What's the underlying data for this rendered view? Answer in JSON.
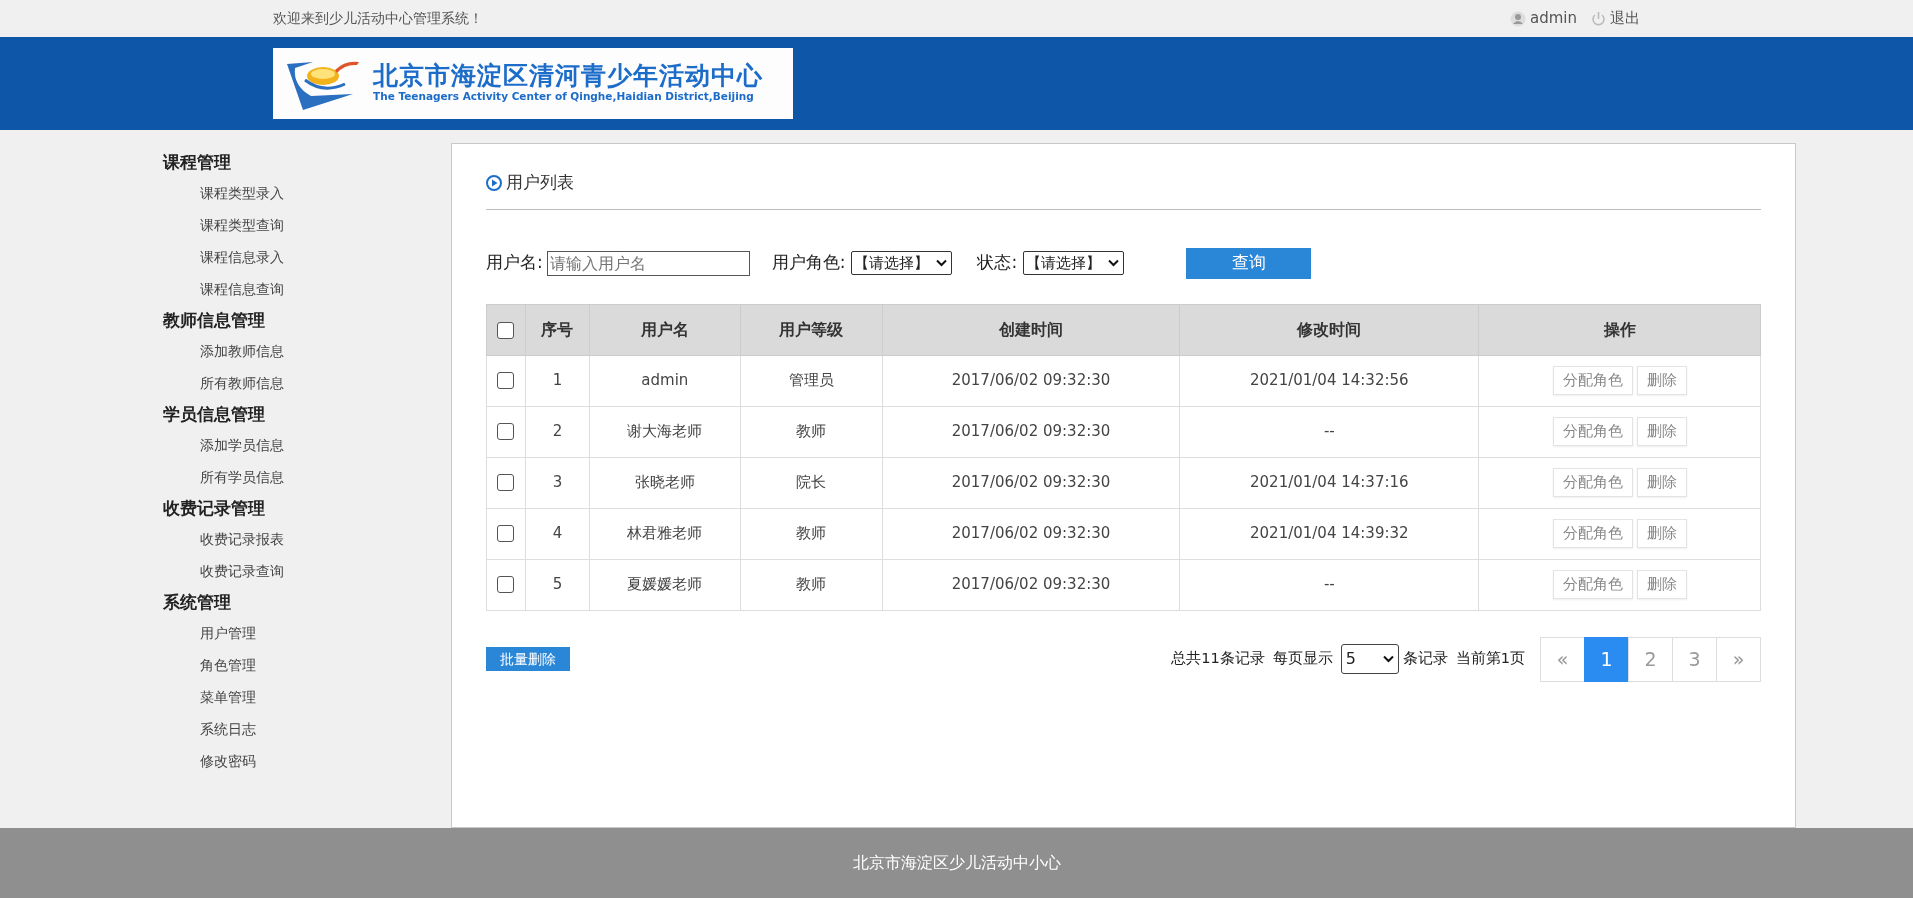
{
  "top_bar": {
    "welcome": "欢迎来到少儿活动中心管理系统！",
    "user": "admin",
    "logout": "退出"
  },
  "logo": {
    "title": "北京市海淀区清河青少年活动中心",
    "subtitle": "The Teenagers Activity Center of Qinghe,Haidian District,Beijing"
  },
  "sidebar": {
    "groups": [
      {
        "title": "课程管理",
        "items": [
          "课程类型录入",
          "课程类型查询",
          "课程信息录入",
          "课程信息查询"
        ]
      },
      {
        "title": "教师信息管理",
        "items": [
          "添加教师信息",
          "所有教师信息"
        ]
      },
      {
        "title": "学员信息管理",
        "items": [
          "添加学员信息",
          "所有学员信息"
        ]
      },
      {
        "title": "收费记录管理",
        "items": [
          "收费记录报表",
          "收费记录查询"
        ]
      },
      {
        "title": "系统管理",
        "items": [
          "用户管理",
          "角色管理",
          "菜单管理",
          "系统日志",
          "修改密码"
        ]
      }
    ]
  },
  "panel_title": "用户列表",
  "filters": {
    "username_label": "用户名:",
    "username_placeholder": "请输入用户名",
    "role_label": "用户角色:",
    "role_value": "【请选择】",
    "status_label": "状态:",
    "status_value": "【请选择】",
    "query_button": "查询"
  },
  "table": {
    "select_all_checked": false,
    "columns": [
      "序号",
      "用户名",
      "用户等级",
      "创建时间",
      "修改时间",
      "操作"
    ],
    "rows": [
      {
        "checked": false,
        "cells": [
          "1",
          "admin",
          "管理员",
          "2017/06/02 09:32:30",
          "2021/01/04 14:32:56"
        ],
        "actions": [
          "分配角色",
          "删除"
        ]
      },
      {
        "checked": false,
        "cells": [
          "2",
          "谢大海老师",
          "教师",
          "2017/06/02 09:32:30",
          "--"
        ],
        "actions": [
          "分配角色",
          "删除"
        ]
      },
      {
        "checked": false,
        "cells": [
          "3",
          "张晓老师",
          "院长",
          "2017/06/02 09:32:30",
          "2021/01/04 14:37:16"
        ],
        "actions": [
          "分配角色",
          "删除"
        ]
      },
      {
        "checked": false,
        "cells": [
          "4",
          "林君雅老师",
          "教师",
          "2017/06/02 09:32:30",
          "2021/01/04 14:39:32"
        ],
        "actions": [
          "分配角色",
          "删除"
        ]
      },
      {
        "checked": false,
        "cells": [
          "5",
          "夏媛媛老师",
          "教师",
          "2017/06/02 09:32:30",
          "--"
        ],
        "actions": [
          "分配角色",
          "删除"
        ]
      }
    ]
  },
  "batch_delete": "批量删除",
  "pagination_info": {
    "total": "总共11条记录",
    "per_page_label": "每页显示",
    "per_page_value": "5",
    "per_page_suffix": "条记录",
    "current": "当前第1页"
  },
  "pagination": [
    {
      "label": "«",
      "selected": false
    },
    {
      "label": "1",
      "selected": true
    },
    {
      "label": "2",
      "selected": false
    },
    {
      "label": "3",
      "selected": false
    },
    {
      "label": "»",
      "selected": false
    }
  ],
  "footer": "北京市海淀区少儿活动中小心"
}
